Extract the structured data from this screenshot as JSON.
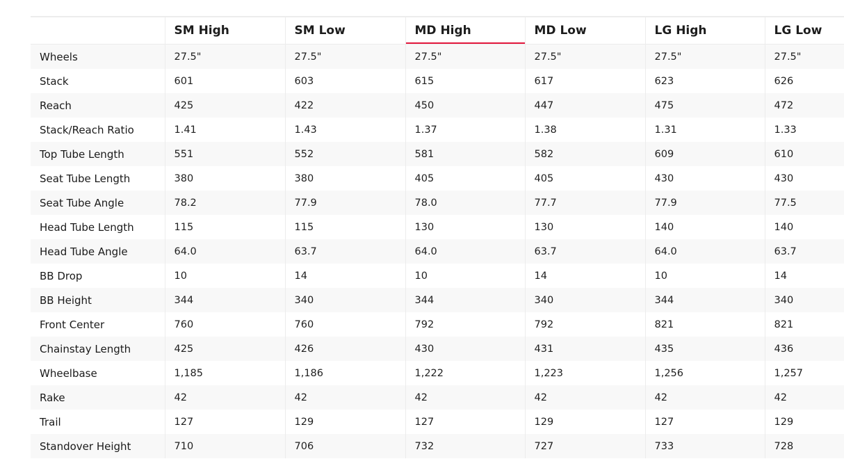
{
  "table": {
    "columns": [
      "",
      "SM High",
      "SM Low",
      "MD High",
      "MD Low",
      "LG High",
      "LG Low"
    ],
    "active_column_index": 3,
    "accent_color": "#e2173c",
    "rows": [
      {
        "label": "Wheels",
        "values": [
          "27.5\"",
          "27.5\"",
          "27.5\"",
          "27.5\"",
          "27.5\"",
          "27.5\""
        ]
      },
      {
        "label": "Stack",
        "values": [
          "601",
          "603",
          "615",
          "617",
          "623",
          "626"
        ]
      },
      {
        "label": "Reach",
        "values": [
          "425",
          "422",
          "450",
          "447",
          "475",
          "472"
        ]
      },
      {
        "label": "Stack/Reach Ratio",
        "values": [
          "1.41",
          "1.43",
          "1.37",
          "1.38",
          "1.31",
          "1.33"
        ]
      },
      {
        "label": "Top Tube Length",
        "values": [
          "551",
          "552",
          "581",
          "582",
          "609",
          "610"
        ]
      },
      {
        "label": "Seat Tube Length",
        "values": [
          "380",
          "380",
          "405",
          "405",
          "430",
          "430"
        ]
      },
      {
        "label": "Seat Tube Angle",
        "values": [
          "78.2",
          "77.9",
          "78.0",
          "77.7",
          "77.9",
          "77.5"
        ]
      },
      {
        "label": "Head Tube Length",
        "values": [
          "115",
          "115",
          "130",
          "130",
          "140",
          "140"
        ]
      },
      {
        "label": "Head Tube Angle",
        "values": [
          "64.0",
          "63.7",
          "64.0",
          "63.7",
          "64.0",
          "63.7"
        ]
      },
      {
        "label": "BB Drop",
        "values": [
          "10",
          "14",
          "10",
          "14",
          "10",
          "14"
        ]
      },
      {
        "label": "BB Height",
        "values": [
          "344",
          "340",
          "344",
          "340",
          "344",
          "340"
        ]
      },
      {
        "label": "Front Center",
        "values": [
          "760",
          "760",
          "792",
          "792",
          "821",
          "821"
        ]
      },
      {
        "label": "Chainstay Length",
        "values": [
          "425",
          "426",
          "430",
          "431",
          "435",
          "436"
        ]
      },
      {
        "label": "Wheelbase",
        "values": [
          "1,185",
          "1,186",
          "1,222",
          "1,223",
          "1,256",
          "1,257"
        ]
      },
      {
        "label": "Rake",
        "values": [
          "42",
          "42",
          "42",
          "42",
          "42",
          "42"
        ]
      },
      {
        "label": "Trail",
        "values": [
          "127",
          "129",
          "127",
          "129",
          "127",
          "129"
        ]
      },
      {
        "label": "Standover Height",
        "values": [
          "710",
          "706",
          "732",
          "727",
          "733",
          "728"
        ]
      }
    ]
  }
}
